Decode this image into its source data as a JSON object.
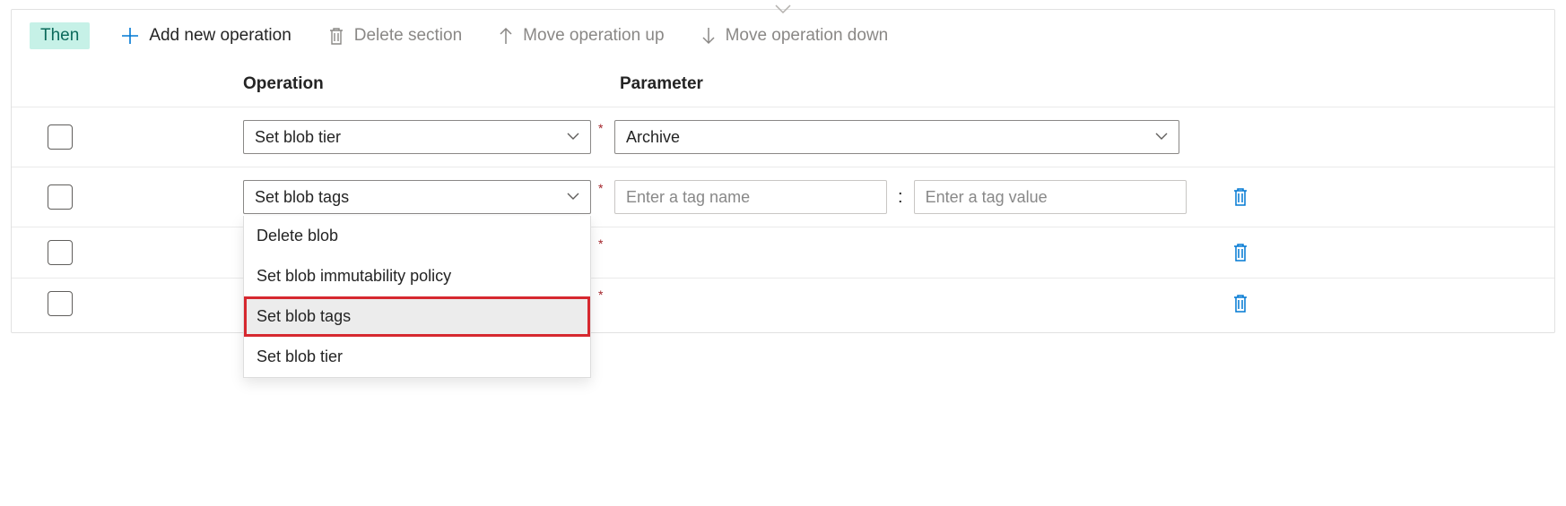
{
  "toolbar": {
    "then_label": "Then",
    "add_label": "Add new operation",
    "delete_section_label": "Delete section",
    "move_up_label": "Move operation up",
    "move_down_label": "Move operation down"
  },
  "headers": {
    "operation": "Operation",
    "parameter": "Parameter"
  },
  "rows": [
    {
      "operation": "Set blob tier",
      "parameter_type": "select",
      "parameter_value": "Archive",
      "show_trash": false
    },
    {
      "operation": "Set blob tags",
      "parameter_type": "tag",
      "tag_name_placeholder": "Enter a tag name",
      "tag_value_placeholder": "Enter a tag value",
      "show_trash": true,
      "dropdown_open": true
    },
    {
      "operation": "",
      "parameter_type": "none",
      "show_trash": true
    },
    {
      "operation": "",
      "parameter_type": "none",
      "show_trash": true
    }
  ],
  "dropdown": {
    "options": [
      {
        "label": "Delete blob",
        "hover": false,
        "highlight": false
      },
      {
        "label": "Set blob immutability policy",
        "hover": false,
        "highlight": false
      },
      {
        "label": "Set blob tags",
        "hover": true,
        "highlight": true
      },
      {
        "label": "Set blob tier",
        "hover": false,
        "highlight": false
      }
    ]
  }
}
